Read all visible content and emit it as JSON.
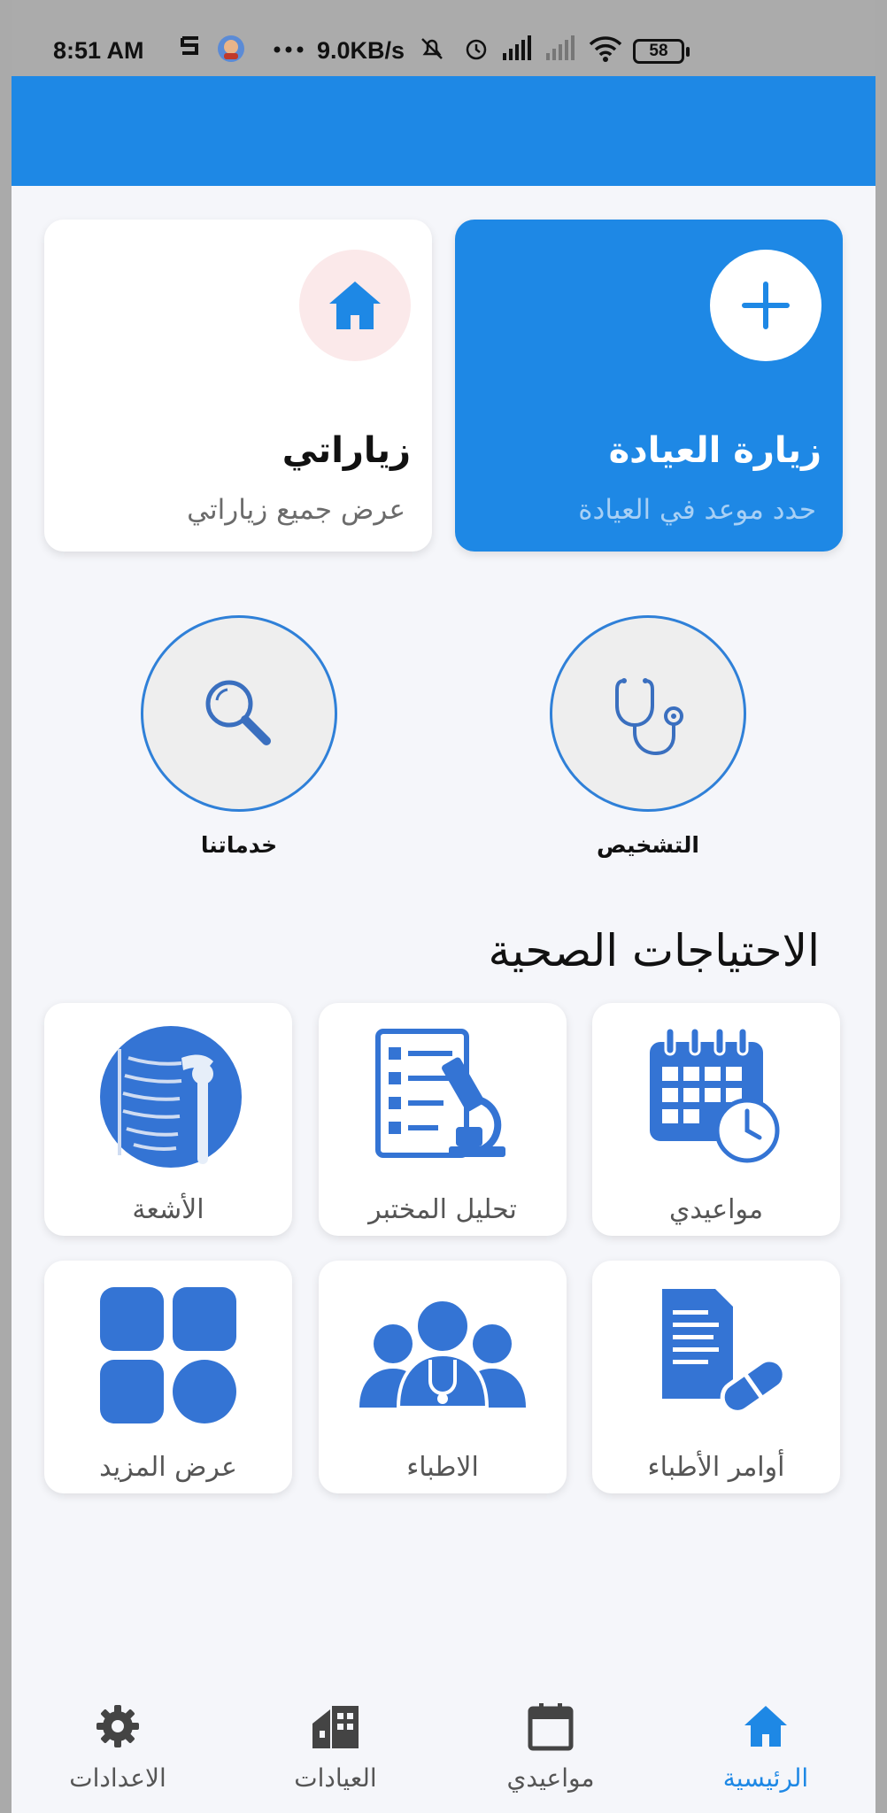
{
  "status_bar": {
    "time": "8:51 AM",
    "network_speed": "9.0KB/s",
    "battery": "58",
    "icons": [
      "sim-icon",
      "app-notification-icon",
      "more-dots-icon",
      "mute-icon",
      "alarm-icon",
      "signal-icon",
      "signal-2-icon",
      "wifi-icon",
      "battery-icon"
    ]
  },
  "colors": {
    "primary": "#1e88e5",
    "background": "#f5f6fa",
    "icon_blue": "#3474d4",
    "home_circle": "#fbe9ea"
  },
  "cards": {
    "visit": {
      "title": "زيارة العيادة",
      "subtitle": "حدد موعد في العيادة",
      "icon": "plus-icon"
    },
    "my_visits": {
      "title": "زياراتي",
      "subtitle": "عرض جميع زياراتي",
      "icon": "home-icon"
    }
  },
  "round_buttons": {
    "diagnosis": {
      "label": "التشخيص",
      "icon": "stethoscope-icon"
    },
    "services": {
      "label": "خدماتنا",
      "icon": "magnifier-icon"
    }
  },
  "section": {
    "title": "الاحتياجات الصحية"
  },
  "tiles": {
    "appointments": {
      "label": "مواعيدي",
      "icon": "calendar-clock-icon"
    },
    "lab": {
      "label": "تحليل المختبر",
      "icon": "lab-checklist-microscope-icon"
    },
    "radiology": {
      "label": "الأشعة",
      "icon": "xray-icon"
    },
    "orders": {
      "label": "أوامر الأطباء",
      "icon": "prescription-pill-icon"
    },
    "doctors": {
      "label": "الاطباء",
      "icon": "doctors-group-icon"
    },
    "more": {
      "label": "عرض المزيد",
      "icon": "grid-icon"
    }
  },
  "bottom_nav": {
    "home": {
      "label": "الرئيسية",
      "icon": "home-icon",
      "active": true
    },
    "appointments": {
      "label": "مواعيدي",
      "icon": "calendar-icon"
    },
    "clinics": {
      "label": "العيادات",
      "icon": "clinic-building-icon"
    },
    "settings": {
      "label": "الاعدادات",
      "icon": "gear-icon"
    }
  }
}
